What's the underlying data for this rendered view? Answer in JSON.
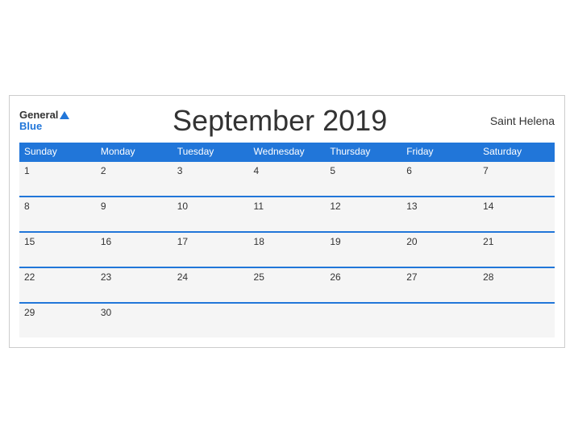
{
  "header": {
    "logo_general": "General",
    "logo_blue": "Blue",
    "title": "September 2019",
    "region": "Saint Helena"
  },
  "weekdays": [
    "Sunday",
    "Monday",
    "Tuesday",
    "Wednesday",
    "Thursday",
    "Friday",
    "Saturday"
  ],
  "weeks": [
    [
      {
        "day": "1"
      },
      {
        "day": "2"
      },
      {
        "day": "3"
      },
      {
        "day": "4"
      },
      {
        "day": "5"
      },
      {
        "day": "6"
      },
      {
        "day": "7"
      }
    ],
    [
      {
        "day": "8"
      },
      {
        "day": "9"
      },
      {
        "day": "10"
      },
      {
        "day": "11"
      },
      {
        "day": "12"
      },
      {
        "day": "13"
      },
      {
        "day": "14"
      }
    ],
    [
      {
        "day": "15"
      },
      {
        "day": "16"
      },
      {
        "day": "17"
      },
      {
        "day": "18"
      },
      {
        "day": "19"
      },
      {
        "day": "20"
      },
      {
        "day": "21"
      }
    ],
    [
      {
        "day": "22"
      },
      {
        "day": "23"
      },
      {
        "day": "24"
      },
      {
        "day": "25"
      },
      {
        "day": "26"
      },
      {
        "day": "27"
      },
      {
        "day": "28"
      }
    ],
    [
      {
        "day": "29"
      },
      {
        "day": "30"
      },
      {
        "day": ""
      },
      {
        "day": ""
      },
      {
        "day": ""
      },
      {
        "day": ""
      },
      {
        "day": ""
      }
    ]
  ],
  "colors": {
    "header_bg": "#2176d9",
    "row_border": "#2176d9",
    "cell_bg": "#f5f5f5"
  }
}
